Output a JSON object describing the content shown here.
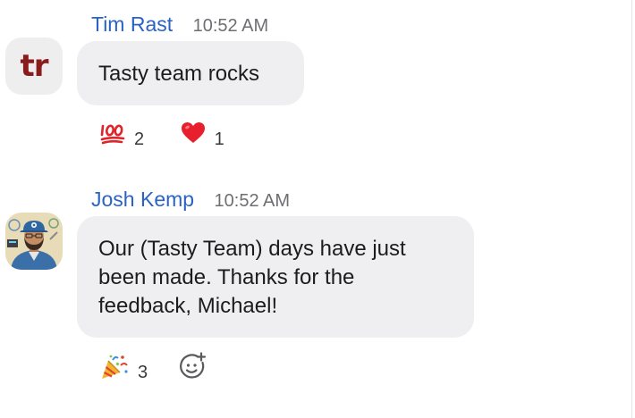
{
  "messages": [
    {
      "sender": "Tim Rast",
      "time": "10:52 AM",
      "avatar_initials": "tr",
      "text": "Tasty team rocks",
      "reactions": [
        {
          "emoji": "hundred-points-icon",
          "count": "2"
        },
        {
          "emoji": "red-heart-icon",
          "count": "1"
        }
      ]
    },
    {
      "sender": "Josh Kemp",
      "time": "10:52 AM",
      "avatar": "illustrated-portrait-avatar",
      "text_lines": [
        "Our (Tasty Team) days have just",
        "been made. Thanks for the",
        "feedback, Michael!"
      ],
      "reactions": [
        {
          "emoji": "party-popper-icon",
          "count": "3"
        }
      ],
      "add_reaction_icon": "add-reaction-icon"
    }
  ],
  "colors": {
    "sender_name": "#2a63c4",
    "timestamp": "#6e6e73",
    "bubble_background": "#efeff1",
    "initials_avatar_text": "#8a1c1c"
  }
}
